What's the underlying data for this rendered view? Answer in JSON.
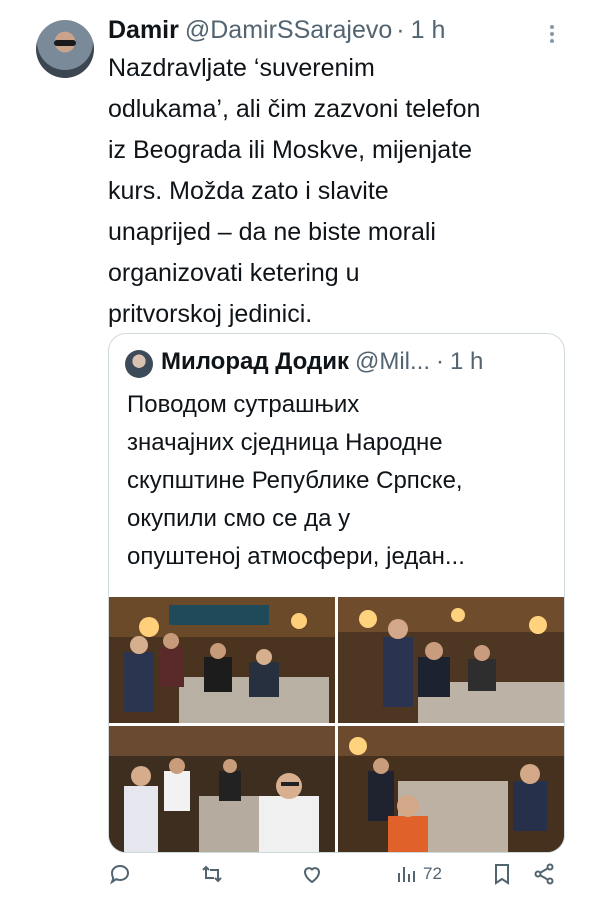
{
  "author": {
    "name": "Damir",
    "handle": "@DamirSSarajevo",
    "separator": "·",
    "time": "1 h",
    "avatar_icon": "user-avatar"
  },
  "post_text_lines": [
    "Nazdravljate ‘suverenim",
    "odlukama’, ali čim zazvoni telefon",
    "iz Beograda ili Moskve, mijenjate",
    "kurs. Možda zato i slavite",
    "unaprijed – da ne biste morali",
    "organizovati ketering u",
    "pritvorskoj jedinici."
  ],
  "quoted": {
    "name": "Милорад Додик",
    "handle": "@Mil...",
    "separator": "·",
    "time": "1 h",
    "text_lines": [
      "Поводом сутрашњих",
      "значајних сједница Народне",
      "скупштине Републике Српске,",
      "окупили смо се да у",
      "опуштеној атмосфери, један..."
    ],
    "photos": [
      "photo-1",
      "photo-2",
      "photo-3",
      "photo-4"
    ]
  },
  "actions": {
    "reply_icon": "reply-icon",
    "retweet_icon": "retweet-icon",
    "like_icon": "heart-icon",
    "views_icon": "views-icon",
    "views_count": "72",
    "bookmark_icon": "bookmark-icon",
    "share_icon": "share-icon"
  },
  "colors": {
    "text": "#0f1419",
    "muted": "#536471",
    "border": "#cfd9de"
  }
}
